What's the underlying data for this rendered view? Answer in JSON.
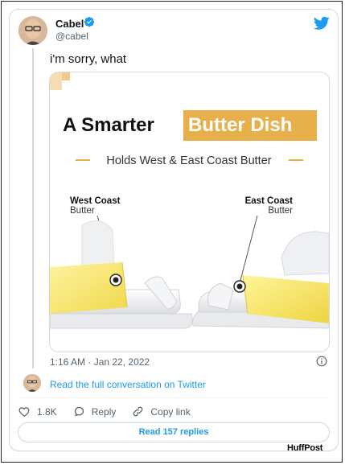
{
  "user": {
    "name": "Cabel",
    "handle": "@cabel"
  },
  "tweet": {
    "text": "i'm sorry, what",
    "timestamp": "1:16 AM · Jan 22, 2022"
  },
  "media": {
    "title_part1": "A Smarter",
    "title_part2": "Butter Dish",
    "subtitle": "Holds West & East Coast Butter",
    "west_label_bold": "West Coast",
    "west_label_sub": "Butter",
    "east_label_bold": "East Coast",
    "east_label_sub": "Butter",
    "accent_color": "#e8b04a"
  },
  "conversation": {
    "link_text": "Read the full conversation on Twitter"
  },
  "actions": {
    "like_count": "1.8K",
    "reply_label": "Reply",
    "copy_label": "Copy link"
  },
  "read_replies": "Read 157 replies",
  "credit": "HuffPost",
  "colors": {
    "twitter_blue": "#1d9bf0",
    "text_gray": "#536471"
  }
}
